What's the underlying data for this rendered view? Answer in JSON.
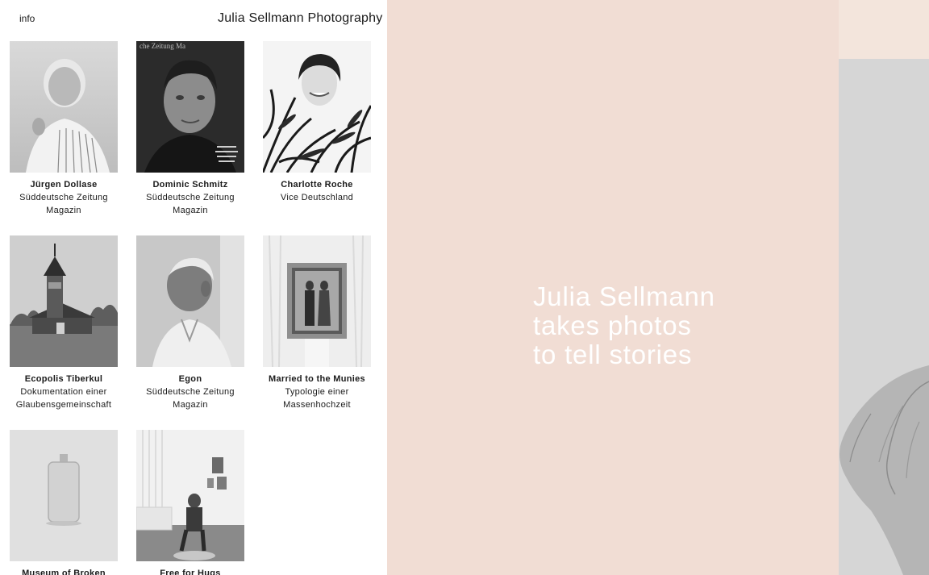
{
  "header": {
    "info_label": "info",
    "site_title": "Julia Sellmann Photography"
  },
  "projects": [
    {
      "name": "Jürgen Dollase",
      "sub_lines": [
        "Süddeutsche Zeitung",
        "Magazin"
      ]
    },
    {
      "name": "Dominic Schmitz",
      "sub_lines": [
        "Süddeutsche Zeitung",
        "Magazin"
      ],
      "thumb_overlay_text": "che Zeitung Ma"
    },
    {
      "name": "Charlotte Roche",
      "sub_lines": [
        "Vice Deutschland"
      ]
    },
    {
      "name": "Ecopolis Tiberkul",
      "sub_lines": [
        "Dokumentation einer",
        "Glaubensgemeinschaft"
      ]
    },
    {
      "name": "Egon",
      "sub_lines": [
        "Süddeutsche Zeitung",
        "Magazin"
      ]
    },
    {
      "name": "Married to the Munies",
      "sub_lines": [
        "Typologie einer",
        "Massenhochzeit"
      ]
    },
    {
      "name": "Museum of Broken",
      "sub_lines": []
    },
    {
      "name": "Free for Hugs",
      "sub_lines": []
    }
  ],
  "hero": {
    "tagline_lines": [
      "Julia Sellmann",
      "takes photos",
      "to tell stories"
    ],
    "background_color": "#f1ddd4",
    "text_color": "#ffffff"
  },
  "side_strip": {
    "background_color": "#f3e5dc",
    "photo_icon": "hand-photo"
  }
}
